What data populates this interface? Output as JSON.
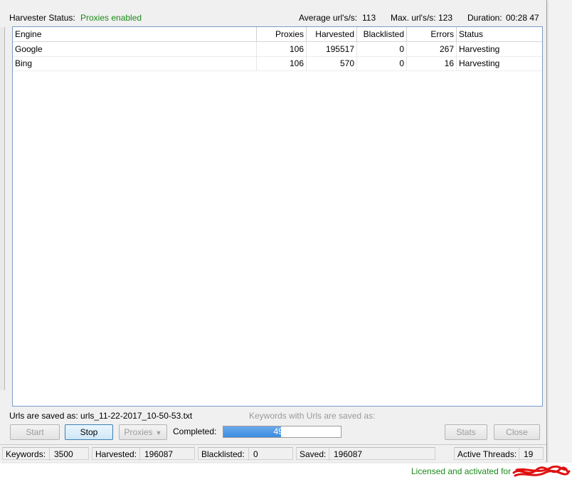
{
  "header": {
    "harvester_status_label": "Harvester Status:",
    "harvester_status_value": "Proxies enabled",
    "avg_label": "Average url's/s:",
    "avg_value": "113",
    "max_label": "Max. url's/s:",
    "max_value": "123",
    "duration_label": "Duration:",
    "duration_value": "00:28 47"
  },
  "table": {
    "columns": [
      "Engine",
      "Proxies",
      "Harvested",
      "Blacklisted",
      "Errors",
      "Status"
    ],
    "rows": [
      [
        "Google",
        "106",
        "195517",
        "0",
        "267",
        "Harvesting"
      ],
      [
        "Bing",
        "106",
        "570",
        "0",
        "16",
        "Harvesting"
      ]
    ]
  },
  "saved": {
    "urls_saved_as": "Urls are saved as: urls_11-22-2017_10-50-53.txt",
    "keywords_saved_as": "Keywords with Urls are saved as:"
  },
  "buttons": {
    "start": "Start",
    "stop": "Stop",
    "proxies": "Proxies",
    "stats": "Stats",
    "close": "Close"
  },
  "progress": {
    "label": "Completed:",
    "text": "49%",
    "percent": 49
  },
  "statusbar": {
    "keywords_label": "Keywords:",
    "keywords_value": "3500",
    "harvested_label": "Harvested:",
    "harvested_value": "196087",
    "blacklisted_label": "Blacklisted:",
    "blacklisted_value": "0",
    "saved_label": "Saved:",
    "saved_value": "196087",
    "threads_label": "Active Threads:",
    "threads_value": "19"
  },
  "license": {
    "text": "Licensed and activated for"
  },
  "colors": {
    "status_green": "#1a8a1a",
    "progress_blue": "#3b8ce0",
    "redaction_red": "#e01010"
  }
}
